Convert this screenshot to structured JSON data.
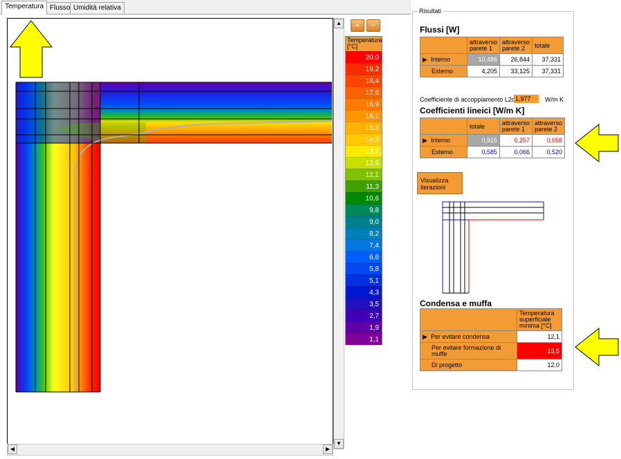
{
  "tabs": [
    "Temperatura",
    "Flusso",
    "Umidità relativa"
  ],
  "zoom": {
    "in": "+",
    "out": "−"
  },
  "legend": {
    "header": "Temperatura [°C]",
    "items": [
      {
        "value": "20,0",
        "color": "#ff0000"
      },
      {
        "value": "19,2",
        "color": "#ff2a00"
      },
      {
        "value": "18,4",
        "color": "#ff4500"
      },
      {
        "value": "17,6",
        "color": "#ff6000"
      },
      {
        "value": "16,9",
        "color": "#ff7a00"
      },
      {
        "value": "16,1",
        "color": "#ff9500"
      },
      {
        "value": "15,3",
        "color": "#ffb000"
      },
      {
        "value": "14,5",
        "color": "#ffc800"
      },
      {
        "value": "13,7",
        "color": "#ffe800"
      },
      {
        "value": "12,9",
        "color": "#c8e000"
      },
      {
        "value": "12,1",
        "color": "#80c000"
      },
      {
        "value": "11,3",
        "color": "#40a000"
      },
      {
        "value": "10,6",
        "color": "#008800"
      },
      {
        "value": "9,8",
        "color": "#008858"
      },
      {
        "value": "9,0",
        "color": "#00808a"
      },
      {
        "value": "8,2",
        "color": "#0080b8"
      },
      {
        "value": "7,4",
        "color": "#0078e0"
      },
      {
        "value": "6,6",
        "color": "#0060ff"
      },
      {
        "value": "5,8",
        "color": "#0048f0"
      },
      {
        "value": "5,1",
        "color": "#0030e0"
      },
      {
        "value": "4,3",
        "color": "#0018d0"
      },
      {
        "value": "3,5",
        "color": "#2010c0"
      },
      {
        "value": "2,7",
        "color": "#4000b8"
      },
      {
        "value": "1,9",
        "color": "#6000a8"
      },
      {
        "value": "1,1",
        "color": "#800098"
      }
    ]
  },
  "results": {
    "title": "Risultati",
    "flussi": {
      "title": "Flussi [W]",
      "headers": [
        "attraverso parete 1",
        "attraverso parete 2",
        "totale"
      ],
      "rows": [
        {
          "label": "Interno",
          "values": [
            "10,486",
            "26,844",
            "37,331"
          ]
        },
        {
          "label": "Esterno",
          "values": [
            "4,205",
            "33,125",
            "37,331"
          ]
        }
      ]
    },
    "coupling": {
      "label": "Coefficiente di accoppiamento L2d",
      "value": "1,977",
      "unit": "W/m K"
    },
    "lineici": {
      "title": "Coefficienti lineici [W/m K]",
      "headers": [
        "totale",
        "attraverso parete 1",
        "attraverso parete 2"
      ],
      "rows": [
        {
          "label": "Interno",
          "values": [
            "0,915",
            "0,257",
            "0,658"
          ]
        },
        {
          "label": "Esterno",
          "values": [
            "0,585",
            "0,066",
            "0,520"
          ]
        }
      ]
    },
    "button": "Visualizza iterazioni",
    "condensa": {
      "title": "Condensa e muffa",
      "header": "Temperatura superficiale minima [°C]",
      "rows": [
        {
          "label": "Per evitare condensa",
          "value": "12,1"
        },
        {
          "label": "Per evitare formazione di muffe",
          "value": "15,5"
        },
        {
          "label": "Di progetto",
          "value": "12,0"
        }
      ]
    }
  },
  "colors": {
    "accent": "#f39c36",
    "highlight": "#ff0000",
    "arrow": "#ffff00"
  }
}
